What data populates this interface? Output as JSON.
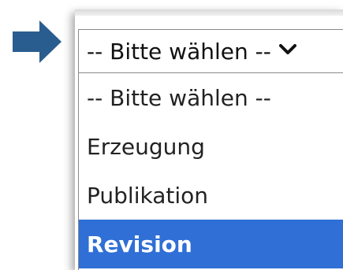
{
  "dropdown": {
    "selected_label": "-- Bitte wählen --",
    "options": [
      {
        "label": "-- Bitte wählen --",
        "highlighted": false
      },
      {
        "label": "Erzeugung",
        "highlighted": false
      },
      {
        "label": "Publikation",
        "highlighted": false
      },
      {
        "label": "Revision",
        "highlighted": true
      }
    ]
  },
  "colors": {
    "arrow": "#2a5d8f",
    "highlight": "#2f6fd6"
  },
  "icons": {
    "pointer": "arrow-right-icon",
    "chevron": "chevron-down-icon"
  }
}
